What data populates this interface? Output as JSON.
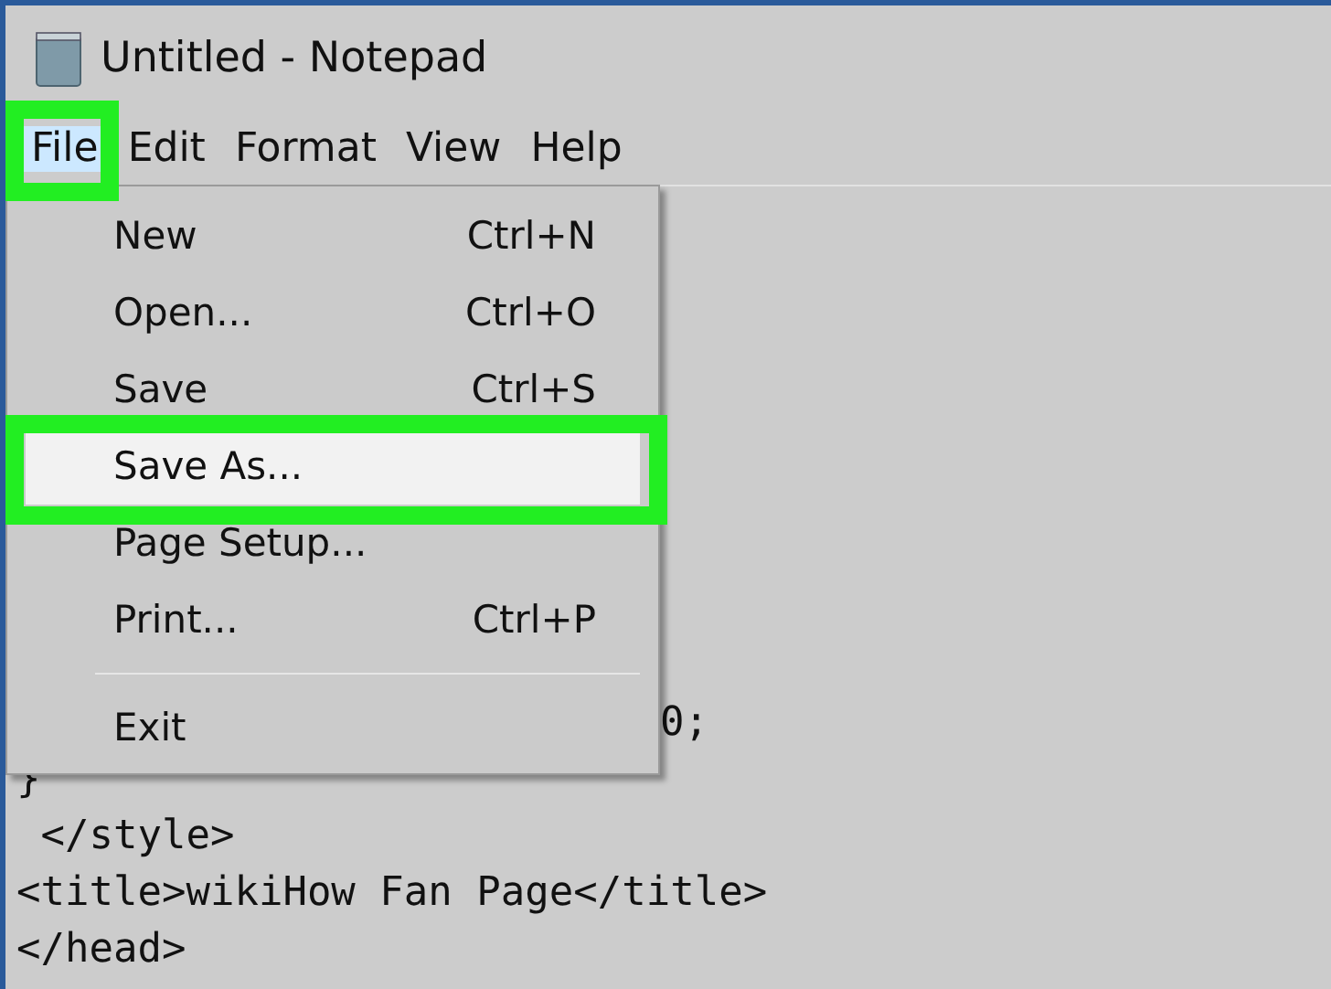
{
  "window": {
    "title": "Untitled - Notepad"
  },
  "menu_bar": [
    {
      "label": "File",
      "selected": true
    },
    {
      "label": "Edit",
      "selected": false
    },
    {
      "label": "Format",
      "selected": false
    },
    {
      "label": "View",
      "selected": false
    },
    {
      "label": "Help",
      "selected": false
    }
  ],
  "file_menu": [
    {
      "kind": "item",
      "label": "New",
      "shortcut": "Ctrl+N",
      "selected": false
    },
    {
      "kind": "item",
      "label": "Open...",
      "shortcut": "Ctrl+O",
      "selected": false
    },
    {
      "kind": "item",
      "label": "Save",
      "shortcut": "Ctrl+S",
      "selected": false
    },
    {
      "kind": "item",
      "label": "Save As...",
      "selected": true
    },
    {
      "kind": "item",
      "label": "Page Setup...",
      "selected": false
    },
    {
      "kind": "item",
      "label": "Print...",
      "shortcut": "Ctrl+P",
      "selected": false
    },
    {
      "kind": "separator"
    },
    {
      "kind": "item",
      "label": "Exit",
      "selected": false
    }
  ],
  "editor_lines": [
    {
      "kind": "fragment",
      "text": "0;"
    },
    {
      "kind": "line",
      "text": "}"
    },
    {
      "kind": "line",
      "text": " </style>"
    },
    {
      "kind": "line",
      "text": "<title>wikiHow Fan Page</title>"
    },
    {
      "kind": "line",
      "text": "</head>"
    }
  ]
}
